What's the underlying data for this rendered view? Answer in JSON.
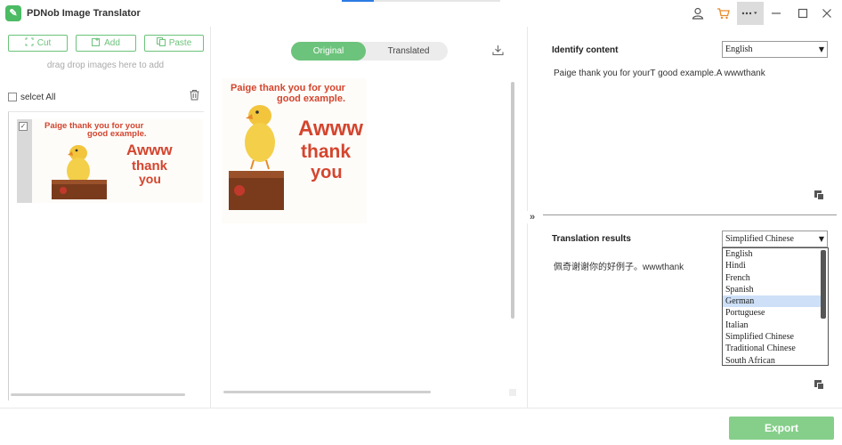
{
  "app": {
    "title": "PDNob Image Translator",
    "logo_glyph": "✎",
    "progress": 0.2
  },
  "toolbar": {
    "cut_label": "Cut",
    "add_label": "Add",
    "paste_label": "Paste",
    "drag_hint": "drag drop images here to add"
  },
  "list": {
    "select_all_label": "selcet All",
    "items": [
      {
        "checked": true
      }
    ]
  },
  "preview": {
    "tabs": [
      "Original",
      "Translated"
    ],
    "active_tab": "Original"
  },
  "image_text": {
    "line1": "Paige thank you for your",
    "line2": "good example.",
    "big1": "Awww",
    "big2": "thank",
    "big3": "you"
  },
  "identify": {
    "label": "Identify content",
    "language": "English",
    "text": "Paige thank you for yourT good example.A wwwthank"
  },
  "translation": {
    "label": "Translation results",
    "language": "Simplified Chinese",
    "text": "佩奇谢谢你的好例子。wwwthank",
    "options": [
      "English",
      "Hindi",
      "French",
      "Spanish",
      "German",
      "Portuguese",
      "Italian",
      "Simplified Chinese",
      "Traditional Chinese",
      "South African"
    ],
    "highlighted": "German"
  },
  "footer": {
    "export_label": "Export"
  },
  "colors": {
    "accent": "#6cc37b",
    "export": "#86cf8a",
    "cart": "#e98a2c",
    "highlight": "#cde0f7"
  }
}
